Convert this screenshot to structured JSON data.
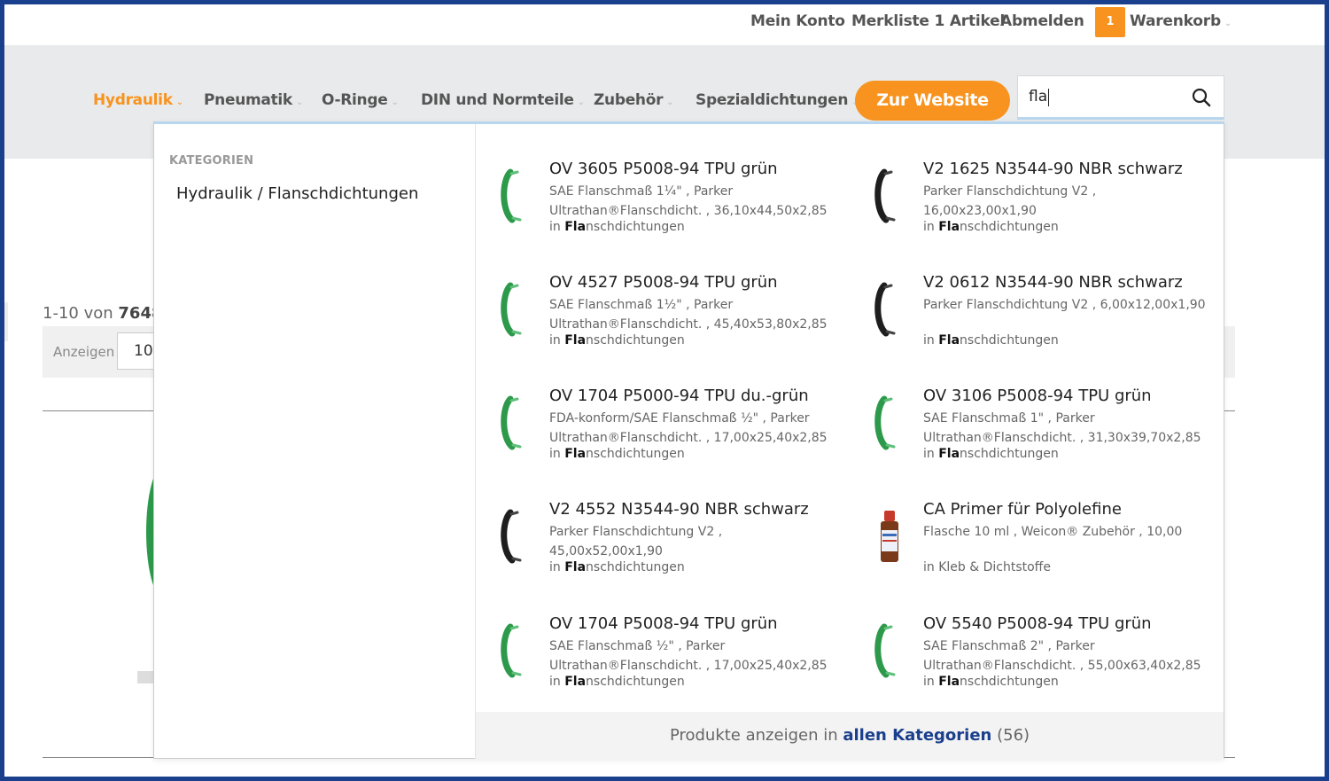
{
  "topbar": {
    "account": "Mein Konto",
    "wishlist": "Merkliste 1 Artikel",
    "logout": "Abmelden",
    "cart_count": "1",
    "cart_label": "Warenkorb"
  },
  "nav": {
    "items": [
      {
        "label": "Hydraulik"
      },
      {
        "label": "Pneumatik"
      },
      {
        "label": "O-Ringe"
      },
      {
        "label": "DIN und Normteile"
      },
      {
        "label": "Zubehör"
      },
      {
        "label": "Spezialdichtungen"
      }
    ],
    "cta": "Zur Website",
    "search_value": "fla"
  },
  "background": {
    "count_prefix": "1-10 von",
    "count_total": "7648",
    "show_label": "Anzeigen",
    "show_value": "10"
  },
  "dropdown": {
    "categories_heading": "KATEGORIEN",
    "category_item": "Hydraulik / Flanschdichtungen",
    "products": [
      {
        "name": "OV 3605 P5008-94 TPU grün",
        "line1": "SAE Flanschmaß 1¼\" , Parker",
        "line2": "Ultrathan®Flanschdicht. , 36,10x44,50x2,85",
        "in_prefix": "in",
        "hl": "Fla",
        "rest": "nschdichtungen",
        "icon": "green-seal-icon"
      },
      {
        "name": "V2 1625 N3544-90 NBR schwarz",
        "line1": "Parker Flanschdichtung V2 ,",
        "line2": "16,00x23,00x1,90",
        "in_prefix": "in",
        "hl": "Fla",
        "rest": "nschdichtungen",
        "icon": "black-seal-icon"
      },
      {
        "name": "OV 4527 P5008-94 TPU grün",
        "line1": "SAE Flanschmaß 1½\" , Parker",
        "line2": "Ultrathan®Flanschdicht. , 45,40x53,80x2,85",
        "in_prefix": "in",
        "hl": "Fla",
        "rest": "nschdichtungen",
        "icon": "green-seal-icon"
      },
      {
        "name": "V2 0612 N3544-90 NBR schwarz",
        "line1": "Parker Flanschdichtung V2 , 6,00x12,00x1,90",
        "line2": "",
        "in_prefix": "in",
        "hl": "Fla",
        "rest": "nschdichtungen",
        "icon": "black-seal-icon"
      },
      {
        "name": "OV 1704 P5000-94 TPU du.-grün",
        "line1": "FDA-konform/SAE Flanschmaß ½\" , Parker",
        "line2": "Ultrathan®Flanschdicht. , 17,00x25,40x2,85",
        "in_prefix": "in",
        "hl": "Fla",
        "rest": "nschdichtungen",
        "icon": "green-seal-icon"
      },
      {
        "name": "OV 3106 P5008-94 TPU grün",
        "line1": "SAE Flanschmaß 1\" , Parker",
        "line2": "Ultrathan®Flanschdicht. , 31,30x39,70x2,85",
        "in_prefix": "in",
        "hl": "Fla",
        "rest": "nschdichtungen",
        "icon": "green-seal-icon"
      },
      {
        "name": "V2 4552 N3544-90 NBR schwarz",
        "line1": "Parker Flanschdichtung V2 ,",
        "line2": "45,00x52,00x1,90",
        "in_prefix": "in",
        "hl": "Fla",
        "rest": "nschdichtungen",
        "icon": "black-seal-icon"
      },
      {
        "name": "CA Primer für Polyolefine",
        "line1": "Flasche 10 ml , Weicon® Zubehör , 10,00",
        "line2": "",
        "in_prefix": "in",
        "hl": "",
        "rest": "Kleb & Dichtstoffe",
        "icon": "bottle-icon"
      },
      {
        "name": "OV 1704 P5008-94 TPU grün",
        "line1": "SAE Flanschmaß ½\" , Parker",
        "line2": "Ultrathan®Flanschdicht. , 17,00x25,40x2,85",
        "in_prefix": "in",
        "hl": "Fla",
        "rest": "nschdichtungen",
        "icon": "green-seal-icon"
      },
      {
        "name": "OV 5540 P5008-94 TPU grün",
        "line1": "SAE Flanschmaß 2\" , Parker",
        "line2": "Ultrathan®Flanschdicht. , 55,00x63,40x2,85",
        "in_prefix": "in",
        "hl": "Fla",
        "rest": "nschdichtungen",
        "icon": "green-seal-icon"
      }
    ],
    "footer_prefix": "Produkte anzeigen in",
    "footer_link": "allen Kategorien",
    "footer_count": "(56)"
  },
  "colors": {
    "accent": "#f7931e",
    "link": "#1a3f8c",
    "seal_green": "#2c9a4a",
    "seal_black": "#1e1e1e"
  }
}
